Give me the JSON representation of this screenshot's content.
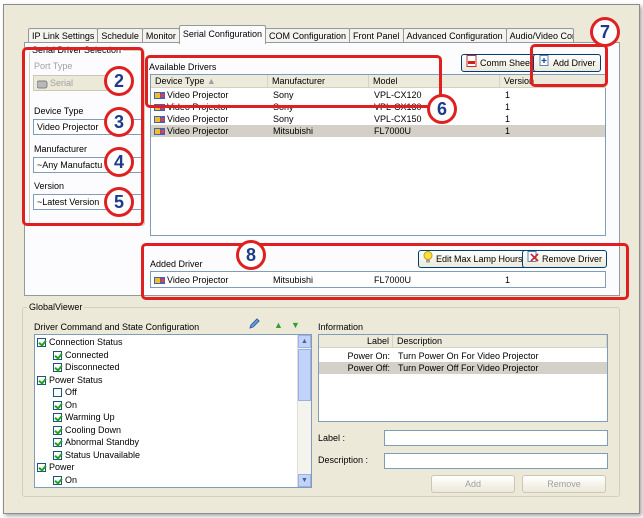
{
  "tabs": [
    "IP Link Settings",
    "Schedule",
    "Monitor",
    "Serial Configuration",
    "COM Configuration",
    "Front Panel",
    "Advanced Configuration",
    "Audio/Video Confi"
  ],
  "active_tab": "Serial Configuration",
  "serial_driver": {
    "title": "Serial Driver Selection",
    "port_type_label": "Port Type",
    "port_type_value": "Serial",
    "device_type_label": "Device Type",
    "device_type_value": "Video Projector",
    "manufacturer_label": "Manufacturer",
    "manufacturer_value": "~Any Manufactu",
    "version_label": "Version",
    "version_value": "~Latest Version"
  },
  "available": {
    "title": "Available Drivers",
    "comm_sheet": "Comm Sheet",
    "add_driver": "Add Driver",
    "columns": [
      "Device Type",
      "Manufacturer",
      "Model",
      "Version"
    ],
    "rows": [
      [
        "Video Projector",
        "Sony",
        "VPL-CX120",
        "1"
      ],
      [
        "Video Projector",
        "Sony",
        "VPL-CX130",
        "1"
      ],
      [
        "Video Projector",
        "Sony",
        "VPL-CX150",
        "1"
      ],
      [
        "Video Projector",
        "Mitsubishi",
        "FL7000U",
        "1"
      ]
    ]
  },
  "added": {
    "title": "Added Driver",
    "edit_lamp": "Edit Max Lamp Hours",
    "remove_driver": "Remove Driver",
    "row": [
      "Video Projector",
      "Mitsubishi",
      "FL7000U",
      "1"
    ]
  },
  "globalviewer": {
    "title": "GlobalViewer",
    "config_title": "Driver Command and State Configuration",
    "tree": [
      {
        "label": "Connection Status",
        "indent": 0,
        "checked": true
      },
      {
        "label": "Connected",
        "indent": 1,
        "checked": true
      },
      {
        "label": "Disconnected",
        "indent": 1,
        "checked": true
      },
      {
        "label": "Power Status",
        "indent": 0,
        "checked": true
      },
      {
        "label": "Off",
        "indent": 1,
        "checked": false
      },
      {
        "label": "On",
        "indent": 1,
        "checked": true
      },
      {
        "label": "Warming Up",
        "indent": 1,
        "checked": true
      },
      {
        "label": "Cooling Down",
        "indent": 1,
        "checked": true
      },
      {
        "label": "Abnormal Standby",
        "indent": 1,
        "checked": true
      },
      {
        "label": "Status Unavailable",
        "indent": 1,
        "checked": true
      },
      {
        "label": "Power",
        "indent": 0,
        "checked": true
      },
      {
        "label": "On",
        "indent": 1,
        "checked": true
      }
    ],
    "info_title": "Information",
    "info_columns": [
      "Label",
      "Description"
    ],
    "info_rows": [
      [
        "Power On:",
        "Turn Power On For Video Projector"
      ],
      [
        "Power Off:",
        "Turn Power Off For Video Projector"
      ]
    ],
    "label_field": "Label :",
    "description_field": "Description :",
    "add_btn": "Add",
    "remove_btn": "Remove"
  },
  "callouts": [
    "2",
    "3",
    "4",
    "5",
    "6",
    "7",
    "8"
  ],
  "colors": {
    "callout_red": "#e02020",
    "callout_text": "#1e3a8a",
    "window_bg": "#ece9d8"
  }
}
